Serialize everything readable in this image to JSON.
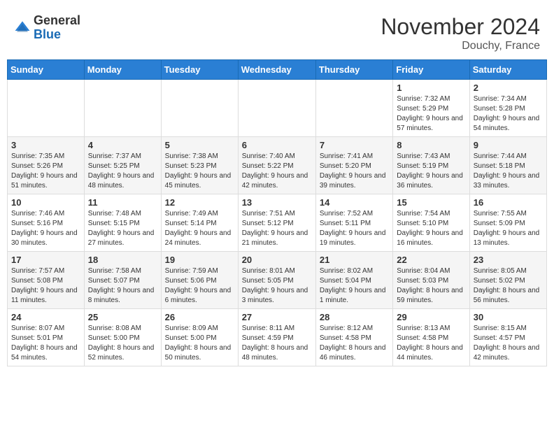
{
  "header": {
    "logo_general": "General",
    "logo_blue": "Blue",
    "month_title": "November 2024",
    "location": "Douchy, France"
  },
  "calendar": {
    "headers": [
      "Sunday",
      "Monday",
      "Tuesday",
      "Wednesday",
      "Thursday",
      "Friday",
      "Saturday"
    ],
    "weeks": [
      [
        {
          "day": "",
          "info": ""
        },
        {
          "day": "",
          "info": ""
        },
        {
          "day": "",
          "info": ""
        },
        {
          "day": "",
          "info": ""
        },
        {
          "day": "",
          "info": ""
        },
        {
          "day": "1",
          "info": "Sunrise: 7:32 AM\nSunset: 5:29 PM\nDaylight: 9 hours and 57 minutes."
        },
        {
          "day": "2",
          "info": "Sunrise: 7:34 AM\nSunset: 5:28 PM\nDaylight: 9 hours and 54 minutes."
        }
      ],
      [
        {
          "day": "3",
          "info": "Sunrise: 7:35 AM\nSunset: 5:26 PM\nDaylight: 9 hours and 51 minutes."
        },
        {
          "day": "4",
          "info": "Sunrise: 7:37 AM\nSunset: 5:25 PM\nDaylight: 9 hours and 48 minutes."
        },
        {
          "day": "5",
          "info": "Sunrise: 7:38 AM\nSunset: 5:23 PM\nDaylight: 9 hours and 45 minutes."
        },
        {
          "day": "6",
          "info": "Sunrise: 7:40 AM\nSunset: 5:22 PM\nDaylight: 9 hours and 42 minutes."
        },
        {
          "day": "7",
          "info": "Sunrise: 7:41 AM\nSunset: 5:20 PM\nDaylight: 9 hours and 39 minutes."
        },
        {
          "day": "8",
          "info": "Sunrise: 7:43 AM\nSunset: 5:19 PM\nDaylight: 9 hours and 36 minutes."
        },
        {
          "day": "9",
          "info": "Sunrise: 7:44 AM\nSunset: 5:18 PM\nDaylight: 9 hours and 33 minutes."
        }
      ],
      [
        {
          "day": "10",
          "info": "Sunrise: 7:46 AM\nSunset: 5:16 PM\nDaylight: 9 hours and 30 minutes."
        },
        {
          "day": "11",
          "info": "Sunrise: 7:48 AM\nSunset: 5:15 PM\nDaylight: 9 hours and 27 minutes."
        },
        {
          "day": "12",
          "info": "Sunrise: 7:49 AM\nSunset: 5:14 PM\nDaylight: 9 hours and 24 minutes."
        },
        {
          "day": "13",
          "info": "Sunrise: 7:51 AM\nSunset: 5:12 PM\nDaylight: 9 hours and 21 minutes."
        },
        {
          "day": "14",
          "info": "Sunrise: 7:52 AM\nSunset: 5:11 PM\nDaylight: 9 hours and 19 minutes."
        },
        {
          "day": "15",
          "info": "Sunrise: 7:54 AM\nSunset: 5:10 PM\nDaylight: 9 hours and 16 minutes."
        },
        {
          "day": "16",
          "info": "Sunrise: 7:55 AM\nSunset: 5:09 PM\nDaylight: 9 hours and 13 minutes."
        }
      ],
      [
        {
          "day": "17",
          "info": "Sunrise: 7:57 AM\nSunset: 5:08 PM\nDaylight: 9 hours and 11 minutes."
        },
        {
          "day": "18",
          "info": "Sunrise: 7:58 AM\nSunset: 5:07 PM\nDaylight: 9 hours and 8 minutes."
        },
        {
          "day": "19",
          "info": "Sunrise: 7:59 AM\nSunset: 5:06 PM\nDaylight: 9 hours and 6 minutes."
        },
        {
          "day": "20",
          "info": "Sunrise: 8:01 AM\nSunset: 5:05 PM\nDaylight: 9 hours and 3 minutes."
        },
        {
          "day": "21",
          "info": "Sunrise: 8:02 AM\nSunset: 5:04 PM\nDaylight: 9 hours and 1 minute."
        },
        {
          "day": "22",
          "info": "Sunrise: 8:04 AM\nSunset: 5:03 PM\nDaylight: 8 hours and 59 minutes."
        },
        {
          "day": "23",
          "info": "Sunrise: 8:05 AM\nSunset: 5:02 PM\nDaylight: 8 hours and 56 minutes."
        }
      ],
      [
        {
          "day": "24",
          "info": "Sunrise: 8:07 AM\nSunset: 5:01 PM\nDaylight: 8 hours and 54 minutes."
        },
        {
          "day": "25",
          "info": "Sunrise: 8:08 AM\nSunset: 5:00 PM\nDaylight: 8 hours and 52 minutes."
        },
        {
          "day": "26",
          "info": "Sunrise: 8:09 AM\nSunset: 5:00 PM\nDaylight: 8 hours and 50 minutes."
        },
        {
          "day": "27",
          "info": "Sunrise: 8:11 AM\nSunset: 4:59 PM\nDaylight: 8 hours and 48 minutes."
        },
        {
          "day": "28",
          "info": "Sunrise: 8:12 AM\nSunset: 4:58 PM\nDaylight: 8 hours and 46 minutes."
        },
        {
          "day": "29",
          "info": "Sunrise: 8:13 AM\nSunset: 4:58 PM\nDaylight: 8 hours and 44 minutes."
        },
        {
          "day": "30",
          "info": "Sunrise: 8:15 AM\nSunset: 4:57 PM\nDaylight: 8 hours and 42 minutes."
        }
      ]
    ]
  }
}
